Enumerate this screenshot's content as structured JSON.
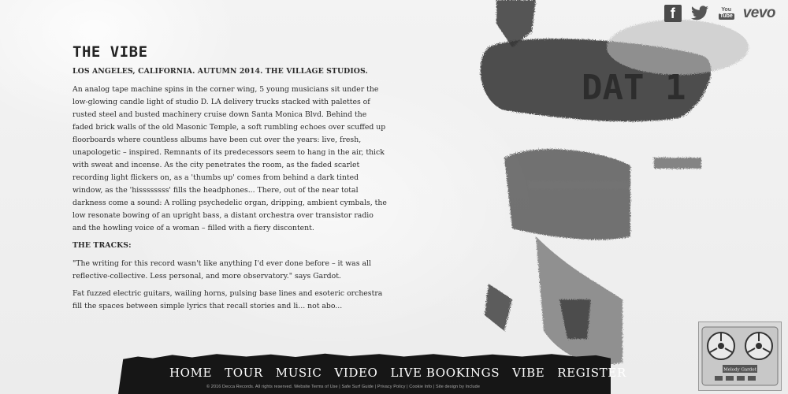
{
  "social": {
    "facebook": "f",
    "youtube_top": "You",
    "youtube_bottom": "Tube",
    "vevo": "vevo"
  },
  "art": {
    "stencil_text": "DAT 1"
  },
  "article": {
    "title": "THE VIBE",
    "dateline": "LOS ANGELES, CALIFORNIA. AUTUMN 2014. THE VILLAGE STUDIOS.",
    "paragraph1": "An analog tape machine spins in the corner wing, 5 young musicians sit under the low-glowing candle light of studio D. LA delivery trucks stacked with palettes of rusted steel and busted machinery cruise down Santa Monica Blvd. Behind the faded brick walls of the old Masonic Temple, a soft rumbling echoes over scuffed up floorboards where countless albums have been cut over the years: live, fresh, unapologetic – inspired. Remnants of its predecessors seem to hang in the air, thick with sweat and incense. As the city penetrates the room, as the faded scarlet recording light flickers on, as a 'thumbs up' comes from behind a dark tinted window, as the 'hissssssss' fills the headphones... There, out of the near total darkness come a sound: A rolling psychedelic organ, dripping, ambient cymbals, the low resonate bowing of an upright bass, a distant orchestra over transistor radio and the howling voice of a woman – filled with a fiery discontent.",
    "tracks_heading": "THE TRACKS:",
    "quote": "\"The writing for this record wasn't like anything I'd ever done before – it was all reflective-collective. Less personal, and more observatory.\" says Gardot.",
    "paragraph3": "Fat fuzzed electric guitars, wailing horns, pulsing base lines and esoteric orchestra fill the spaces between simple lyrics that recall stories and li... not abo..."
  },
  "nav": {
    "items": [
      "HOME",
      "TOUR",
      "MUSIC",
      "VIDEO",
      "LIVE BOOKINGS",
      "VIBE",
      "REGISTER"
    ]
  },
  "footer": {
    "text": "© 2016 Decca Records. All rights reserved. Website Terms of Use | Safe Surf Guide | Privacy Policy | Cookie Info | Site design by Include"
  },
  "player": {
    "label": "Melody Gardot"
  }
}
